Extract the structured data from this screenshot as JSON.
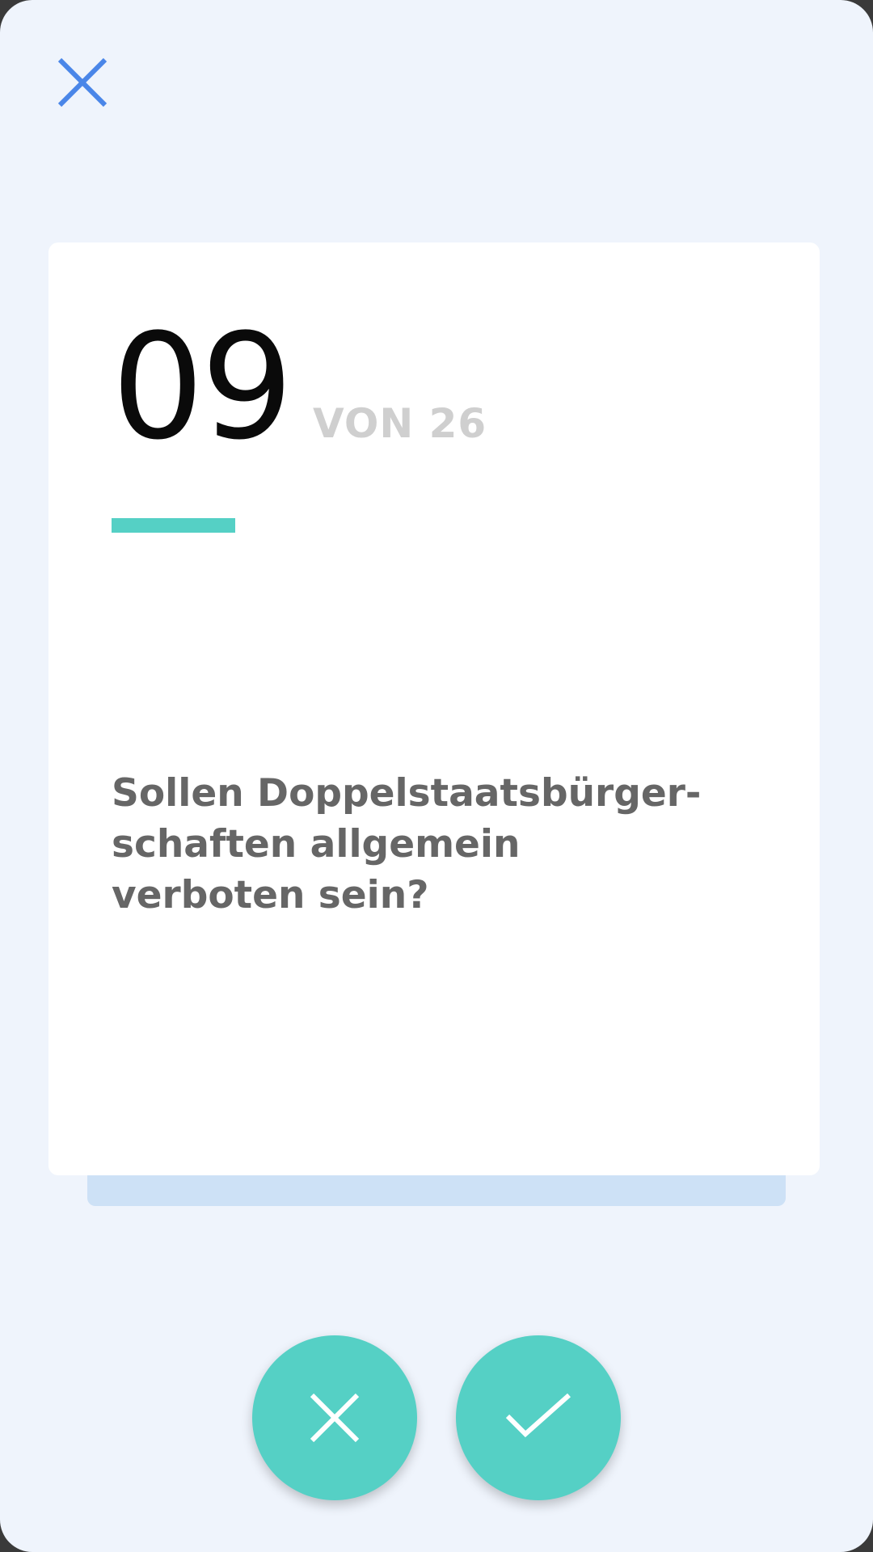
{
  "header": {
    "close_icon": "close-icon",
    "accent_color": "#4a86e8"
  },
  "card": {
    "current": "09",
    "total_label": "VON 26",
    "progress_fraction": 0.1923,
    "question": "Sollen Doppelstaatsbürger-schaften allgemein verboten sein?"
  },
  "actions": {
    "no_icon": "close-icon",
    "yes_icon": "check-icon",
    "button_color": "#55d0c5"
  }
}
